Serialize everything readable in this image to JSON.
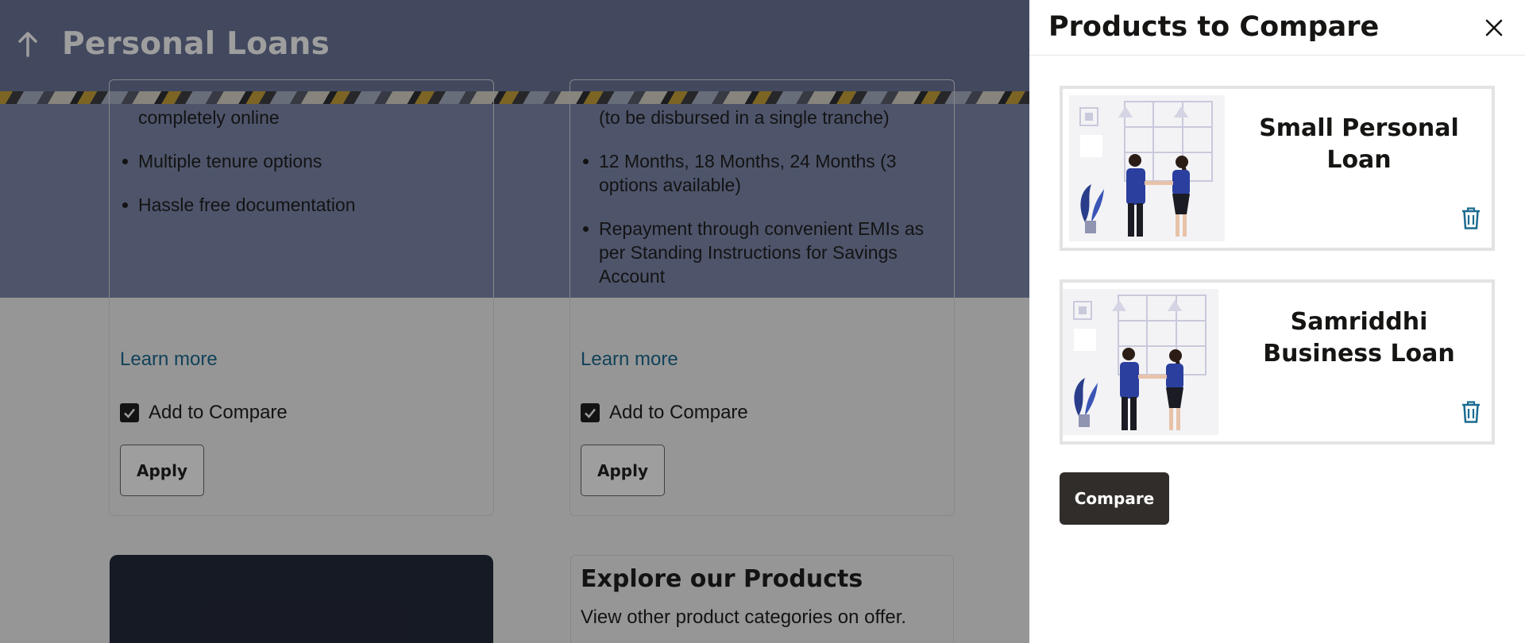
{
  "header": {
    "title": "Personal Loans"
  },
  "products": [
    {
      "features": [
        {
          "text": "completely online",
          "bullet": false
        },
        {
          "text": "Multiple tenure options",
          "bullet": true
        },
        {
          "text": "Hassle free documentation",
          "bullet": true
        }
      ],
      "learn_more": "Learn more",
      "compare_label": "Add to Compare",
      "compare_checked": true,
      "apply_label": "Apply"
    },
    {
      "features": [
        {
          "text": "(to be disbursed in a single tranche)",
          "bullet": false
        },
        {
          "text": "12 Months, 18 Months, 24 Months (3 options available)",
          "bullet": true
        },
        {
          "text": "Repayment through convenient EMIs as per Standing Instructions for Savings Account",
          "bullet": true
        }
      ],
      "learn_more": "Learn more",
      "compare_label": "Add to Compare",
      "compare_checked": true,
      "apply_label": "Apply"
    }
  ],
  "explore": {
    "title": "Explore our Products",
    "subtitle": "View other product categories on offer."
  },
  "drawer": {
    "title": "Products to Compare",
    "close_icon": "close-icon",
    "items": [
      {
        "name": "Small Personal Loan",
        "image_icon": "handshake-illustration",
        "remove_icon": "trash-icon"
      },
      {
        "name": "Samriddhi Business Loan",
        "image_icon": "handshake-illustration",
        "remove_icon": "trash-icon"
      }
    ],
    "compare_label": "Compare"
  },
  "colors": {
    "accent_link": "#1c6b90",
    "trash": "#1c6b90",
    "compare_button": "#312d2a",
    "hero": "#7e8aad"
  }
}
